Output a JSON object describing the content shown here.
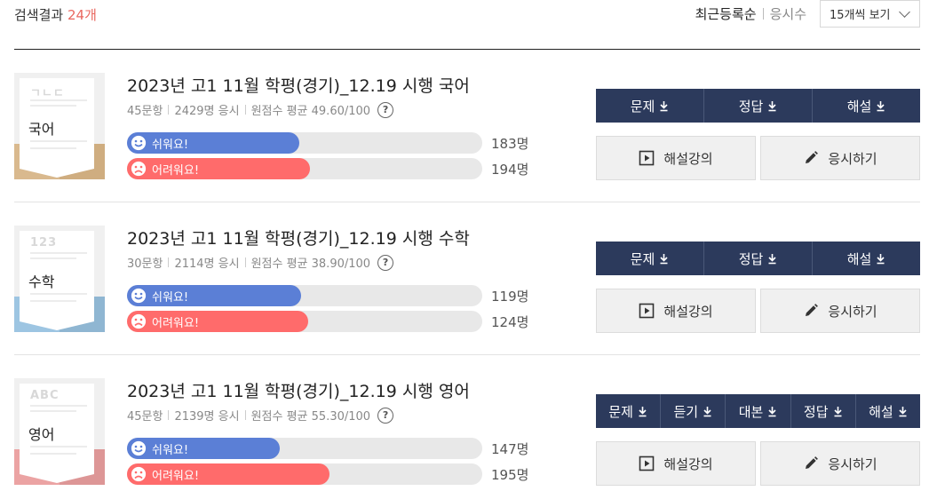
{
  "header": {
    "result_label": "검색결과",
    "result_count": "24개",
    "sort_active": "최근등록순",
    "sort_inactive": "응시수",
    "per_page": "15개씩 보기"
  },
  "items": [
    {
      "subject": "국어",
      "deco": "ㄱㄴㄷ",
      "band_color": "#d9b98e",
      "band_color_dark": "#cfad80",
      "title": "2023년 고1 11월 학평(경기)_12.19 시행 국어",
      "questions": "45문항",
      "takers": "2429명 응시",
      "average": "원점수 평균 49.60/100",
      "help": "?",
      "easy_label": "쉬워요!",
      "easy_count": "183명",
      "easy_ratio": 0.485,
      "hard_label": "어려워요!",
      "hard_count": "194명",
      "hard_ratio": 0.515,
      "downloads": [
        "문제",
        "정답",
        "해설"
      ],
      "lecture": "해설강의",
      "take": "응시하기"
    },
    {
      "subject": "수학",
      "deco": "123",
      "band_color": "#9dc5e2",
      "band_color_dark": "#8fb6d2",
      "title": "2023년 고1 11월 학평(경기)_12.19 시행 수학",
      "questions": "30문항",
      "takers": "2114명 응시",
      "average": "원점수 평균 38.90/100",
      "help": "?",
      "easy_label": "쉬워요!",
      "easy_count": "119명",
      "easy_ratio": 0.49,
      "hard_label": "어려워요!",
      "hard_count": "124명",
      "hard_ratio": 0.51,
      "downloads": [
        "문제",
        "정답",
        "해설"
      ],
      "lecture": "해설강의",
      "take": "응시하기"
    },
    {
      "subject": "영어",
      "deco": "ABC",
      "band_color": "#eba3a3",
      "band_color_dark": "#dd9696",
      "title": "2023년 고1 11월 학평(경기)_12.19 시행 영어",
      "questions": "45문항",
      "takers": "2139명 응시",
      "average": "원점수 평균 55.30/100",
      "help": "?",
      "easy_label": "쉬워요!",
      "easy_count": "147명",
      "easy_ratio": 0.43,
      "hard_label": "어려워요!",
      "hard_count": "195명",
      "hard_ratio": 0.57,
      "downloads": [
        "문제",
        "듣기",
        "대본",
        "정답",
        "해설"
      ],
      "lecture": "해설강의",
      "take": "응시하기"
    }
  ],
  "colors": {
    "accent_count": "#e9675f",
    "easy": "#5b7fd6",
    "hard": "#ff6b6b",
    "download_bar": "#2c3a5c"
  },
  "icons": {
    "download": "download-icon",
    "play": "play-icon",
    "pencil": "pencil-icon",
    "smile": "smile-face-icon",
    "sad": "sad-face-icon",
    "chevron": "chevron-down-icon",
    "help": "question-icon"
  }
}
